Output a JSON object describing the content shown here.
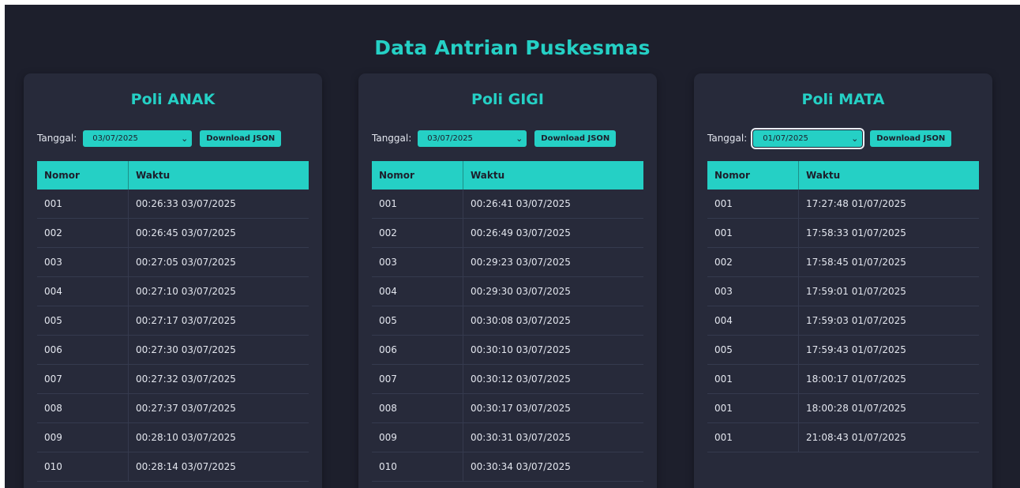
{
  "page": {
    "title": "Data Antrian Puskesmas"
  },
  "colors": {
    "accent": "#25d0c5",
    "background": "#1d1f2c",
    "panel": "#272a3a",
    "text": "#e3e6ee"
  },
  "panels": [
    {
      "title": "Poli ANAK",
      "date_label": "Tanggal:",
      "date_value": "03/07/2025",
      "download_label": "Download JSON",
      "headers": [
        "Nomor",
        "Waktu"
      ],
      "rows": [
        [
          "001",
          "00:26:33 03/07/2025"
        ],
        [
          "002",
          "00:26:45 03/07/2025"
        ],
        [
          "003",
          "00:27:05 03/07/2025"
        ],
        [
          "004",
          "00:27:10 03/07/2025"
        ],
        [
          "005",
          "00:27:17 03/07/2025"
        ],
        [
          "006",
          "00:27:30 03/07/2025"
        ],
        [
          "007",
          "00:27:32 03/07/2025"
        ],
        [
          "008",
          "00:27:37 03/07/2025"
        ],
        [
          "009",
          "00:28:10 03/07/2025"
        ],
        [
          "010",
          "00:28:14 03/07/2025"
        ]
      ]
    },
    {
      "title": "Poli GIGI",
      "date_label": "Tanggal:",
      "date_value": "03/07/2025",
      "download_label": "Download JSON",
      "headers": [
        "Nomor",
        "Waktu"
      ],
      "rows": [
        [
          "001",
          "00:26:41 03/07/2025"
        ],
        [
          "002",
          "00:26:49 03/07/2025"
        ],
        [
          "003",
          "00:29:23 03/07/2025"
        ],
        [
          "004",
          "00:29:30 03/07/2025"
        ],
        [
          "005",
          "00:30:08 03/07/2025"
        ],
        [
          "006",
          "00:30:10 03/07/2025"
        ],
        [
          "007",
          "00:30:12 03/07/2025"
        ],
        [
          "008",
          "00:30:17 03/07/2025"
        ],
        [
          "009",
          "00:30:31 03/07/2025"
        ],
        [
          "010",
          "00:30:34 03/07/2025"
        ]
      ]
    },
    {
      "title": "Poli MATA",
      "date_label": "Tanggal:",
      "date_value": "01/07/2025",
      "download_label": "Download JSON",
      "headers": [
        "Nomor",
        "Waktu"
      ],
      "rows": [
        [
          "001",
          "17:27:48 01/07/2025"
        ],
        [
          "001",
          "17:58:33 01/07/2025"
        ],
        [
          "002",
          "17:58:45 01/07/2025"
        ],
        [
          "003",
          "17:59:01 01/07/2025"
        ],
        [
          "004",
          "17:59:03 01/07/2025"
        ],
        [
          "005",
          "17:59:43 01/07/2025"
        ],
        [
          "001",
          "18:00:17 01/07/2025"
        ],
        [
          "001",
          "18:00:28 01/07/2025"
        ],
        [
          "001",
          "21:08:43 01/07/2025"
        ]
      ]
    }
  ]
}
